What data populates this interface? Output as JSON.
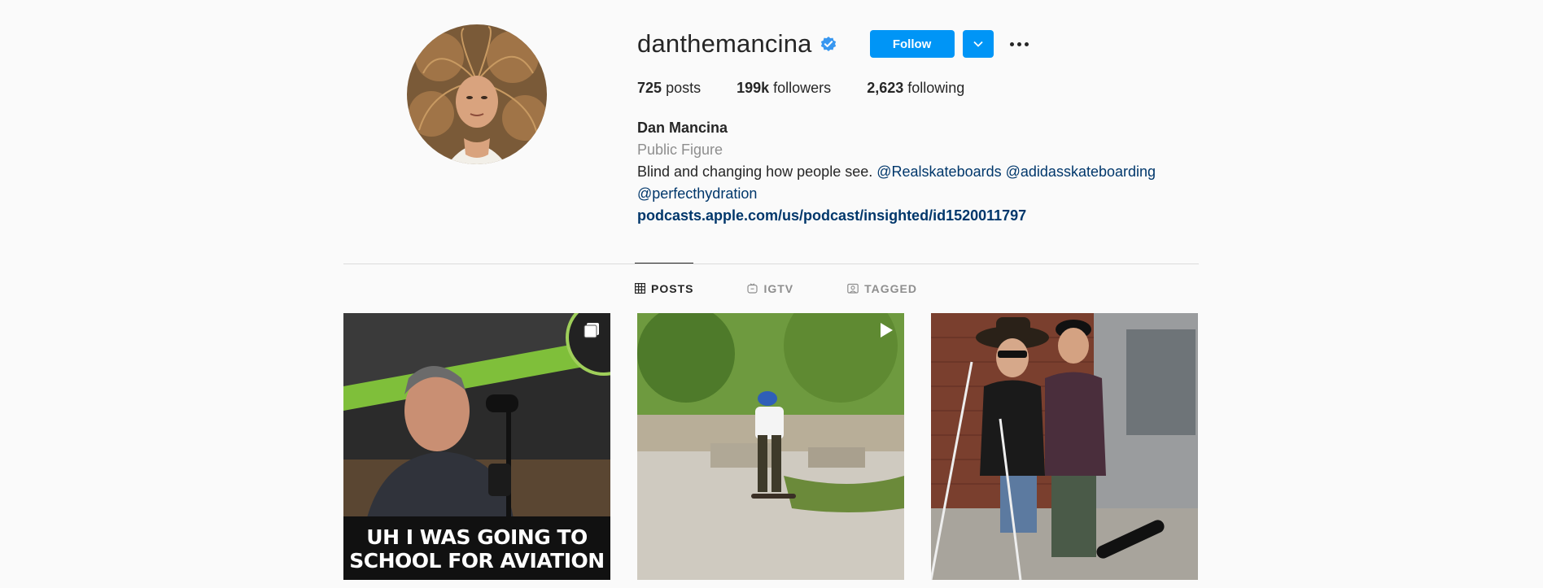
{
  "profile": {
    "username": "danthemancina",
    "verified": true,
    "follow_label": "Follow",
    "stats": {
      "posts_count": "725",
      "posts_label": "posts",
      "followers_count": "199k",
      "followers_label": "followers",
      "following_count": "2,623",
      "following_label": "following"
    },
    "bio": {
      "name": "Dan Mancina",
      "category": "Public Figure",
      "text": "Blind and changing how people see.",
      "mention_1": "@Realskateboards",
      "mention_2": "@adidasskateboarding",
      "mention_3": "@perfecthydration",
      "link": "podcasts.apple.com/us/podcast/insighted/id1520011797"
    }
  },
  "tabs": [
    {
      "label": "POSTS",
      "active": true,
      "icon": "grid-icon"
    },
    {
      "label": "IGTV",
      "active": false,
      "icon": "igtv-icon"
    },
    {
      "label": "TAGGED",
      "active": false,
      "icon": "tagged-icon"
    }
  ],
  "posts": [
    {
      "type": "carousel",
      "badge_icon": "carousel-icon",
      "caption_line_1": "UH I WAS GOING TO",
      "caption_line_2": "SCHOOL FOR AVIATION"
    },
    {
      "type": "video",
      "badge_icon": "play-icon"
    },
    {
      "type": "photo"
    }
  ],
  "colors": {
    "accent": "#0095f6",
    "link": "#00376b",
    "muted": "#8e8e8e",
    "text": "#262626",
    "background": "#fafafa"
  }
}
